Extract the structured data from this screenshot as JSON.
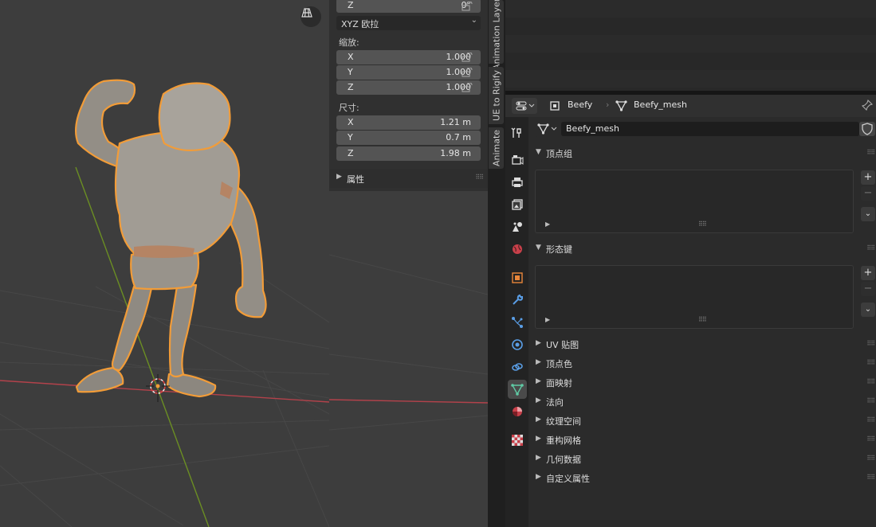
{
  "viewport": {
    "grid_button_icon": "grid-view-icon"
  },
  "npanel": {
    "rotation_z": {
      "axis": "Z",
      "value": "0°"
    },
    "rotation_mode": "XYZ 欧拉",
    "scale_label": "缩放:",
    "scale": [
      {
        "axis": "X",
        "value": "1.000"
      },
      {
        "axis": "Y",
        "value": "1.000"
      },
      {
        "axis": "Z",
        "value": "1.000"
      }
    ],
    "dimensions_label": "尺寸:",
    "dimensions": [
      {
        "axis": "X",
        "value": "1.21 m"
      },
      {
        "axis": "Y",
        "value": "0.7 m"
      },
      {
        "axis": "Z",
        "value": "1.98 m"
      }
    ],
    "attributes_label": "属性"
  },
  "vertical_tabs": [
    "Animation Layers",
    "UE to Rigify",
    "Animate"
  ],
  "properties": {
    "header": {
      "object_name": "Beefy",
      "mesh_name": "Beefy_mesh"
    },
    "datablock_name": "Beefy_mesh",
    "sections": {
      "vertex_groups": "顶点组",
      "shape_keys": "形态键",
      "collapsed": [
        "UV 贴图",
        "顶点色",
        "面映射",
        "法向",
        "纹理空间",
        "重构网格",
        "几何数据",
        "自定义属性"
      ]
    },
    "tabs": [
      "tool",
      "render",
      "output",
      "view-layer",
      "scene",
      "world",
      "object",
      "modifiers",
      "particles",
      "physics",
      "constraints",
      "data",
      "material",
      "texture"
    ],
    "active_tab": "data"
  },
  "colors": {
    "selection_outline": "#f29c38",
    "x_axis": "#b3424b",
    "y_axis": "#6b8e23",
    "active_tab_icon": "#5fc9a4"
  }
}
